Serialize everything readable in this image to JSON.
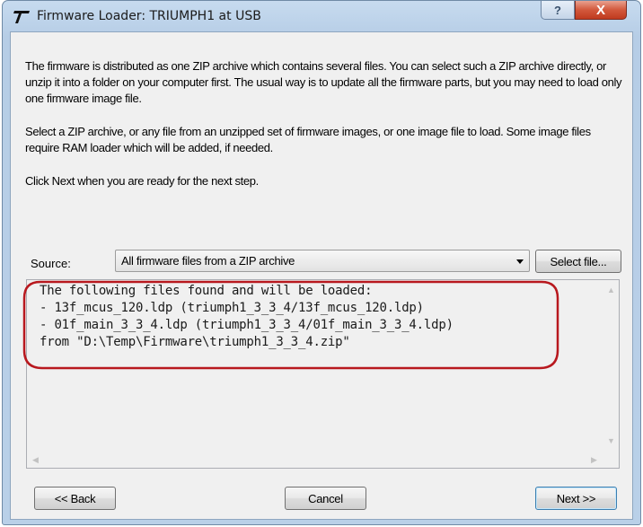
{
  "window": {
    "title": "Firmware Loader: TRIUMPH1 at USB",
    "help_glyph": "?",
    "close_glyph": "X"
  },
  "instructions": {
    "para1": "The firmware is distributed as one ZIP archive which contains several files. You can select such a ZIP archive directly, or unzip it into a folder on your computer first. The usual way is to update all the firmware parts, but you may need to load only one firmware image file.",
    "para2": "Select a ZIP archive, or any file from an unzipped set of firmware images, or one image file to load. Some image files require RAM loader which will be added, if needed.",
    "para3": "Click Next when you are ready for the next step."
  },
  "source": {
    "label": "Source:",
    "selected_value": "All firmware files from a ZIP archive",
    "select_file_label": "Select file..."
  },
  "output": {
    "lines": [
      "The following files found and will be loaded:",
      "- 13f_mcus_120.ldp (triumph1_3_3_4/13f_mcus_120.ldp)",
      "- 01f_main_3_3_4.ldp (triumph1_3_3_4/01f_main_3_3_4.ldp)",
      "from \"D:\\Temp\\Firmware\\triumph1_3_3_4.zip\""
    ]
  },
  "buttons": {
    "back": "<< Back",
    "cancel": "Cancel",
    "next": "Next >>"
  },
  "colors": {
    "highlight_ring": "#b8181e",
    "title_gradient_top": "#c7dbef",
    "close_button": "#c03a1f"
  }
}
